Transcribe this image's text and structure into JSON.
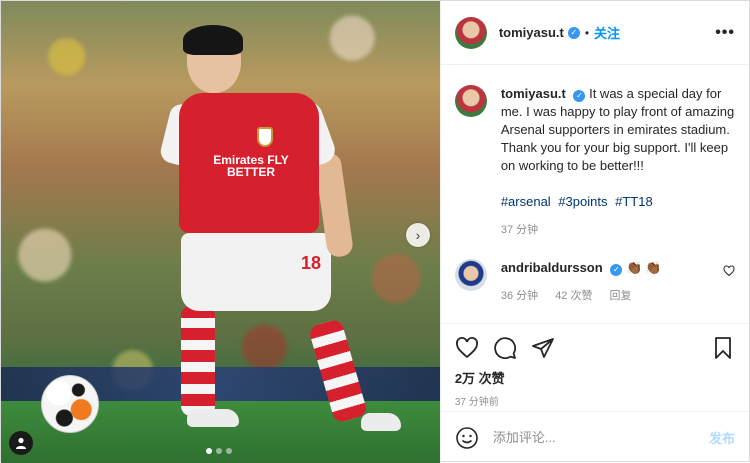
{
  "header": {
    "username": "tomiyasu.t",
    "follow_label": "关注",
    "more": "•••"
  },
  "media": {
    "sponsor_text": "Emirates FLY BETTER",
    "shirt_number": "18",
    "next_icon": "chevron-right-icon",
    "tag_icon": "user-tag-icon",
    "carousel": {
      "total": 3,
      "active": 1
    }
  },
  "caption": {
    "username": "tomiyasu.t",
    "text": "It was a special day for me. I was happy to play front of amazing Arsenal supporters in emirates stadium.\nThank you for your big support. I'll keep on working to be better!!!",
    "hashtags": [
      "#arsenal",
      "#3points",
      "#TT18"
    ],
    "time": "37 分钟"
  },
  "comment": {
    "username": "andribaldursson",
    "text": "👏🏾👏🏾",
    "time": "36 分钟",
    "likes": "42 次赞",
    "reply": "回复"
  },
  "actions": {
    "likes": "2万 次赞",
    "time": "37 分钟前"
  },
  "add_comment": {
    "placeholder": "添加评论...",
    "post_label": "发布"
  },
  "colors": {
    "link_blue": "#0095f6",
    "hashtag_blue": "#00376b",
    "verified_blue": "#3897f0",
    "muted": "#8e8e8e"
  }
}
